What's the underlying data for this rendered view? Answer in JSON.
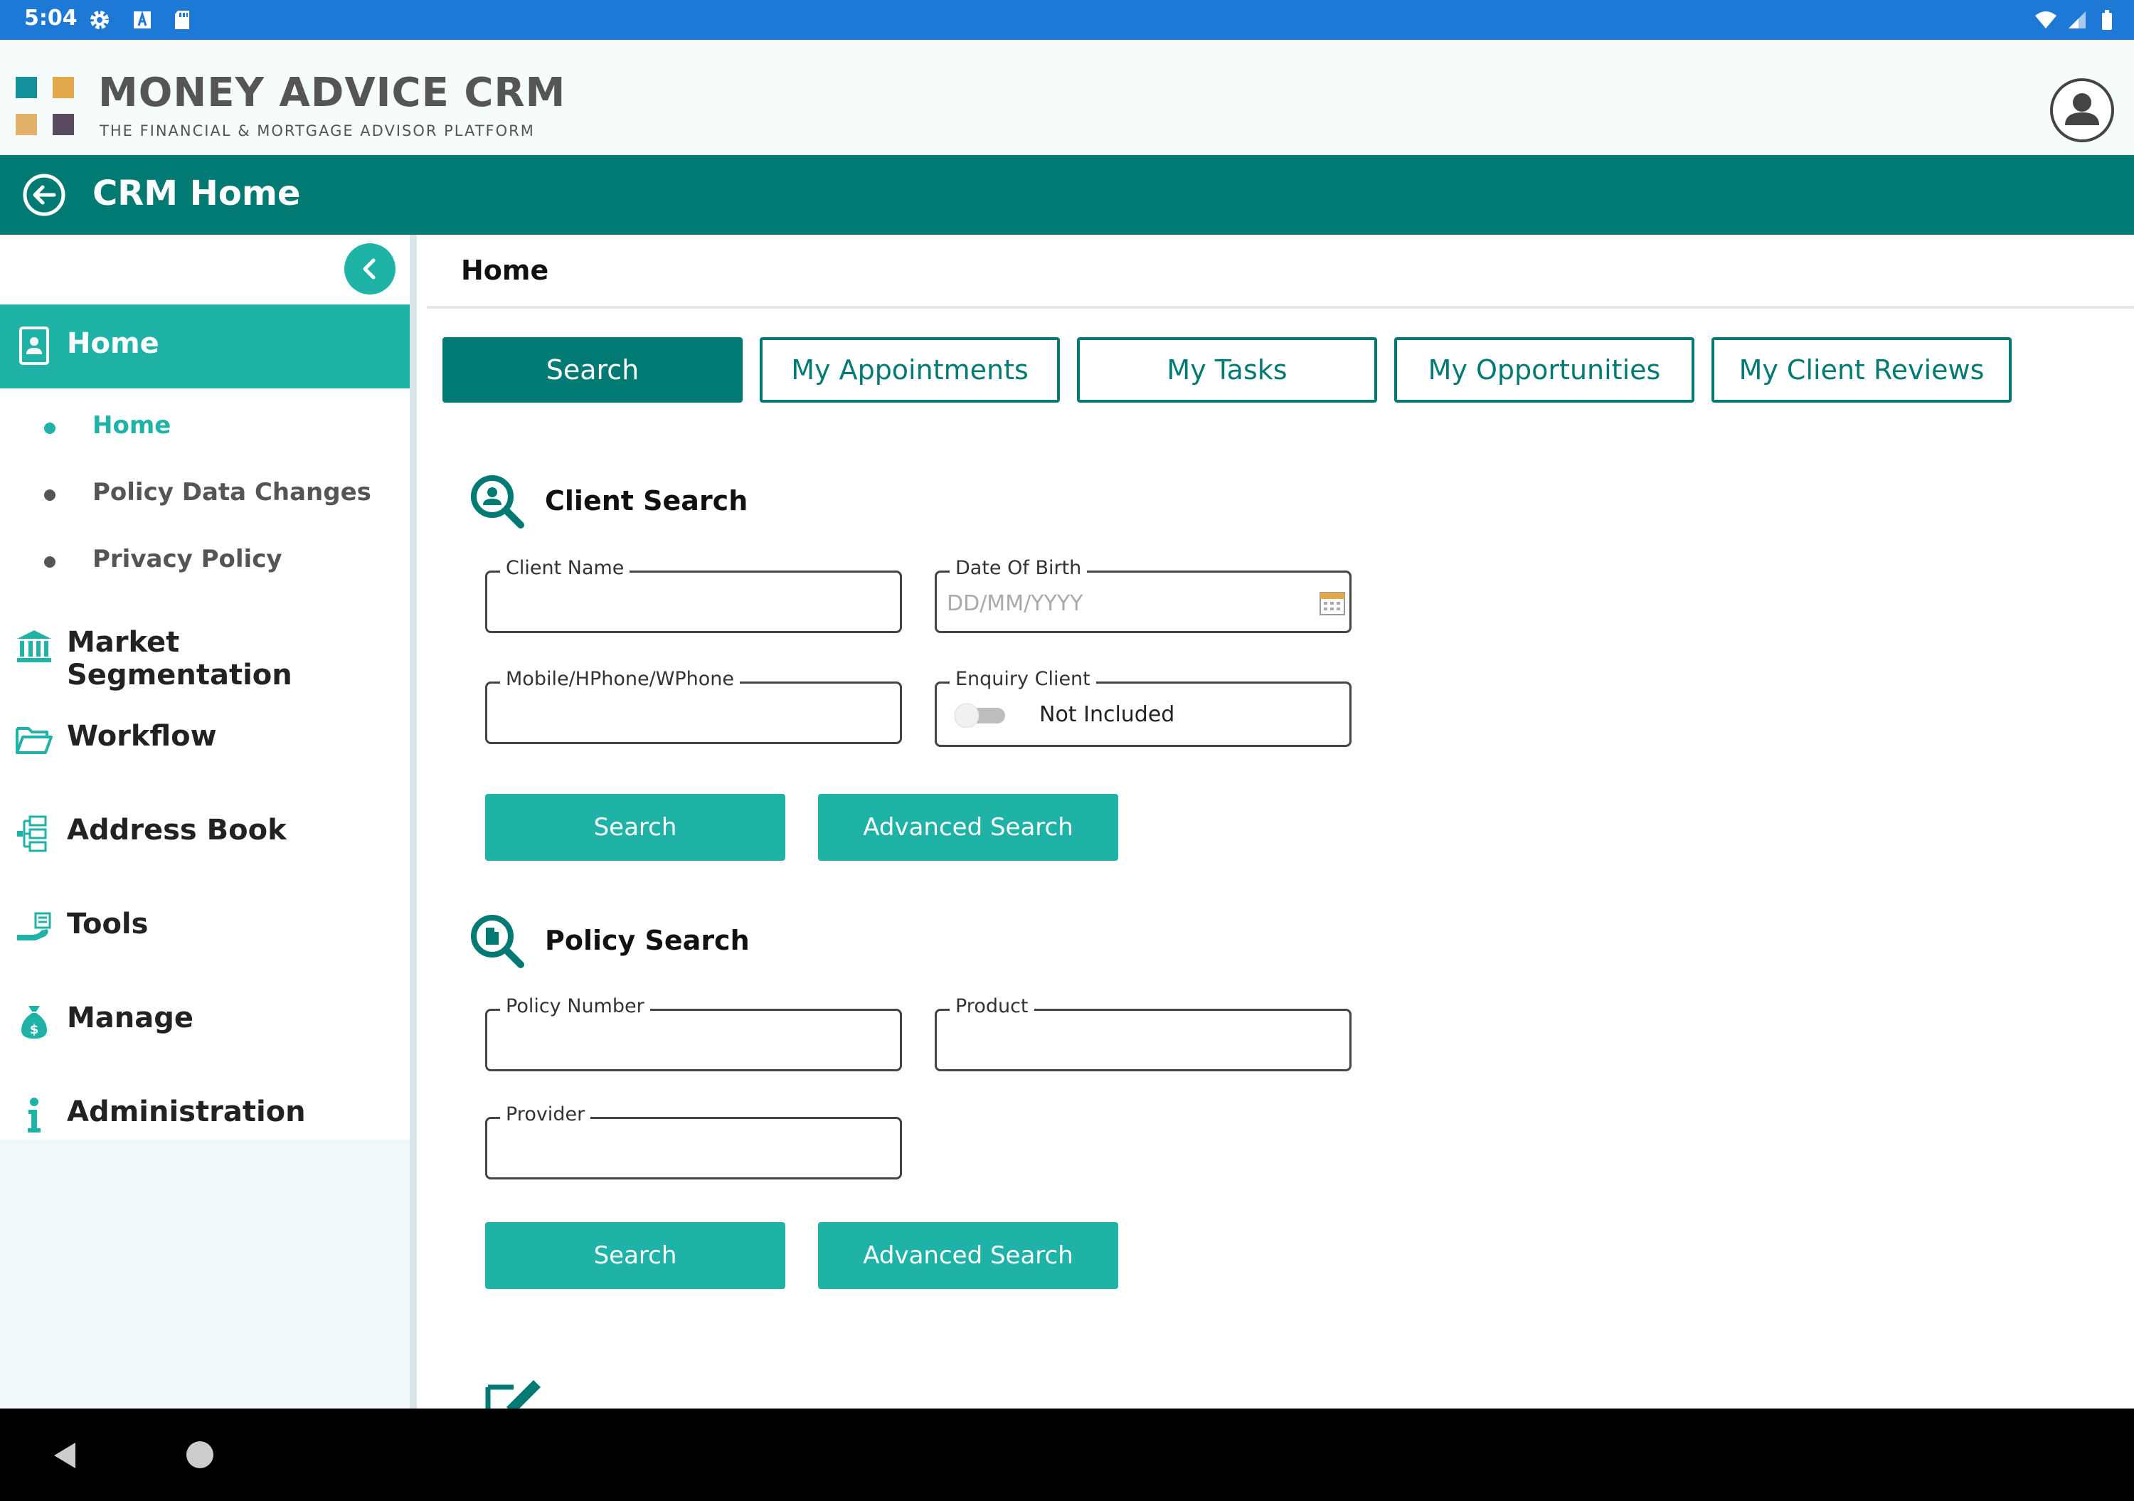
{
  "status_bar": {
    "time": "5:04"
  },
  "brand": {
    "title": "MONEY ADVICE CRM",
    "subtitle": "THE FINANCIAL & MORTGAGE ADVISOR PLATFORM",
    "colors": {
      "teal": "#13909a",
      "orange": "#e2a84a",
      "tan": "#e2b26a",
      "plum": "#5a4a60"
    }
  },
  "titlebar": {
    "title": "CRM Home",
    "color": "#007a72"
  },
  "sidebar": {
    "active_color": "#1fb2a6",
    "home": {
      "label": "Home",
      "icon": "contact-card-icon"
    },
    "sub_items": [
      {
        "label": "Home",
        "active": true
      },
      {
        "label": "Policy Data Changes",
        "active": false
      },
      {
        "label": "Privacy Policy",
        "active": false
      }
    ],
    "items": [
      {
        "label": "Market Segmentation",
        "icon": "bank-icon"
      },
      {
        "label": "Workflow",
        "icon": "folder-open-icon"
      },
      {
        "label": "Address Book",
        "icon": "org-chart-icon"
      },
      {
        "label": "Tools",
        "icon": "hand-tools-icon"
      },
      {
        "label": "Manage",
        "icon": "money-bag-icon"
      },
      {
        "label": "Administration",
        "icon": "info-icon"
      }
    ]
  },
  "main": {
    "breadcrumb": "Home",
    "tabs": [
      {
        "label": "Search",
        "active": true
      },
      {
        "label": "My Appointments",
        "active": false
      },
      {
        "label": "My Tasks",
        "active": false
      },
      {
        "label": "My Opportunities",
        "active": false
      },
      {
        "label": "My Client Reviews",
        "active": false
      }
    ],
    "client_search": {
      "title": "Client Search",
      "client_name": {
        "label": "Client Name",
        "value": ""
      },
      "dob": {
        "label": "Date Of Birth",
        "placeholder": "DD/MM/YYYY"
      },
      "phone": {
        "label": "Mobile/HPhone/WPhone",
        "value": ""
      },
      "enquiry": {
        "label": "Enquiry Client",
        "toggle_text": "Not Included",
        "on": false
      },
      "search_button": "Search",
      "advanced_button": "Advanced Search"
    },
    "policy_search": {
      "title": "Policy Search",
      "policy_number": {
        "label": "Policy Number",
        "value": ""
      },
      "product": {
        "label": "Product",
        "value": ""
      },
      "provider": {
        "label": "Provider",
        "value": ""
      },
      "search_button": "Search",
      "advanced_button": "Advanced Search"
    }
  }
}
